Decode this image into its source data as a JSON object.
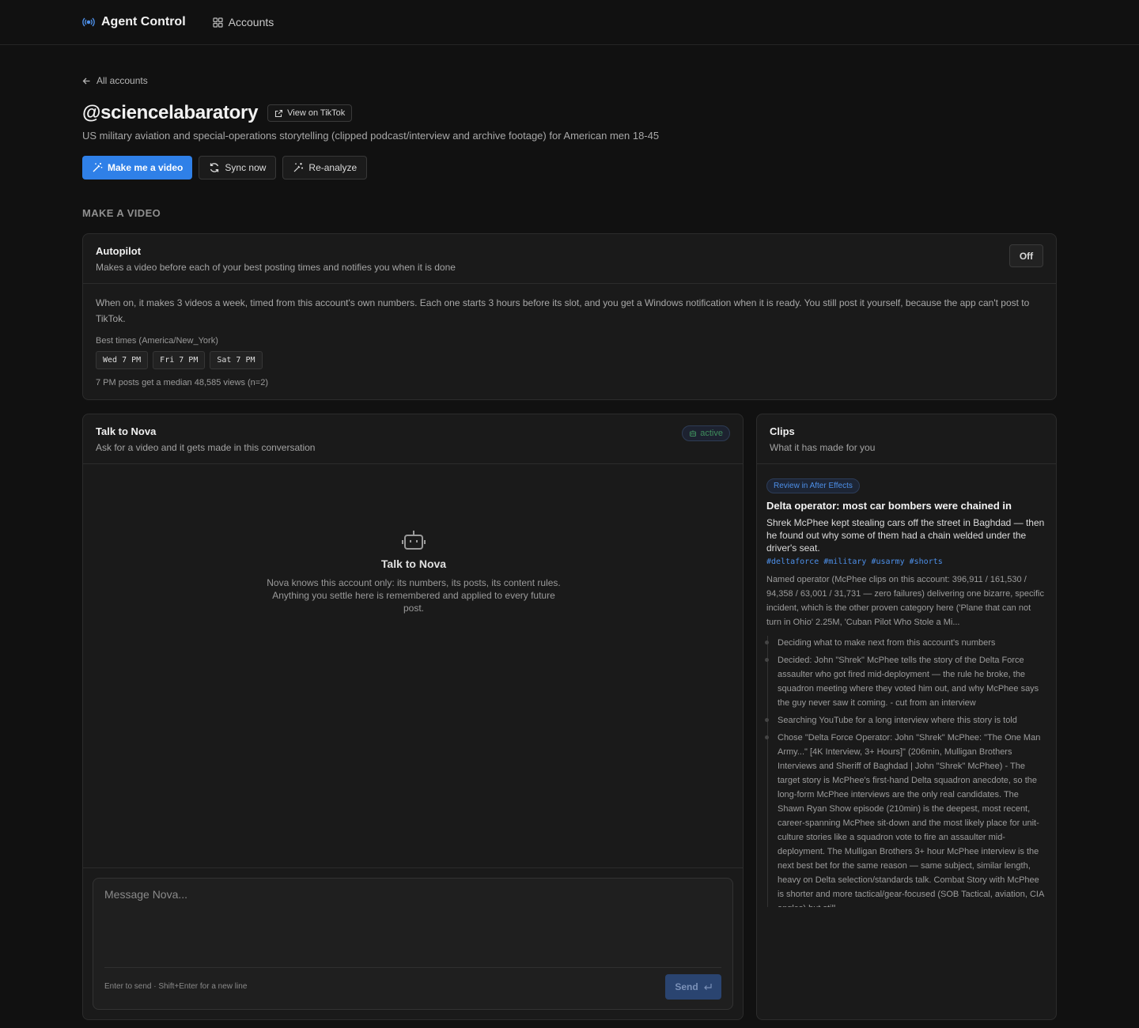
{
  "nav": {
    "brand": "Agent Control",
    "accounts": "Accounts"
  },
  "back": "All accounts",
  "account": {
    "handle": "@sciencelabaratory",
    "view_link": "View on TikTok",
    "description": "US military aviation and special-operations storytelling (clipped podcast/interview and archive footage) for American men 18-45"
  },
  "actions": {
    "make_video": "Make me a video",
    "sync": "Sync now",
    "reanalyze": "Re-analyze"
  },
  "section_label": "MAKE A VIDEO",
  "autopilot": {
    "title": "Autopilot",
    "subtitle": "Makes a video before each of your best posting times and notifies you when it is done",
    "toggle": "Off",
    "body": "When on, it makes 3 videos a week, timed from this account's own numbers. Each one starts 3 hours before its slot, and you get a Windows notification when it is ready. You still post it yourself, because the app can't post to TikTok.",
    "best_label": "Best times (America/New_York)",
    "times": [
      "Wed 7 PM",
      "Fri 7 PM",
      "Sat 7 PM"
    ],
    "median": "7 PM posts get a median 48,585 views (n=2)"
  },
  "chat": {
    "title": "Talk to Nova",
    "subtitle": "Ask for a video and it gets made in this conversation",
    "status": "active",
    "empty_title": "Talk to Nova",
    "empty_text": "Nova knows this account only: its numbers, its posts, its content rules. Anything you settle here is remembered and applied to every future post.",
    "placeholder": "Message Nova...",
    "hint": "Enter to send · Shift+Enter for a new line",
    "send": "Send"
  },
  "clips": {
    "title": "Clips",
    "subtitle": "What it has made for you",
    "badge": "Review in After Effects",
    "clip_title": "Delta operator: most car bombers were chained in",
    "clip_desc": "Shrek McPhee kept stealing cars off the street in Baghdad — then he found out why some of them had a chain welded under the driver's seat.",
    "tags": "#deltaforce #military #usarmy #shorts",
    "reason": "Named operator (McPhee clips on this account: 396,911 / 161,530 / 94,358 / 63,001 / 31,731 — zero failures) delivering one bizarre, specific incident, which is the other proven category here ('Plane that can not turn in Ohio' 2.25M, 'Cuban Pilot Who Stole a Mi...",
    "steps": [
      "Deciding what to make next from this account's numbers",
      "Decided: John \"Shrek\" McPhee tells the story of the Delta Force assaulter who got fired mid-deployment — the rule he broke, the squadron meeting where they voted him out, and why McPhee says the guy never saw it coming. - cut from an interview",
      "Searching YouTube for a long interview where this story is told",
      "Chose \"Delta Force Operator: John \"Shrek\" McPhee: \"The One Man Army...\" [4K Interview, 3+ Hours]\" (206min, Mulligan Brothers Interviews and Sheriff of Baghdad | John \"Shrek\" McPhee) - The target story is McPhee's first-hand Delta squadron anecdote, so the long-form McPhee interviews are the only real candidates. The Shawn Ryan Show episode (210min) is the deepest, most recent, career-spanning McPhee sit-down and the most likely place for unit-culture stories like a squadron vote to fire an assaulter mid-deployment. The Mulligan Brothers 3+ hour McPhee interview is the next best bet for the same reason — same subject, similar length, heavy on Delta selection/standards talk. Combat Story with McPhee is shorter and more tactical/gear-focused (SOB Tactical, aviation, CIA angles) but still"
    ]
  }
}
